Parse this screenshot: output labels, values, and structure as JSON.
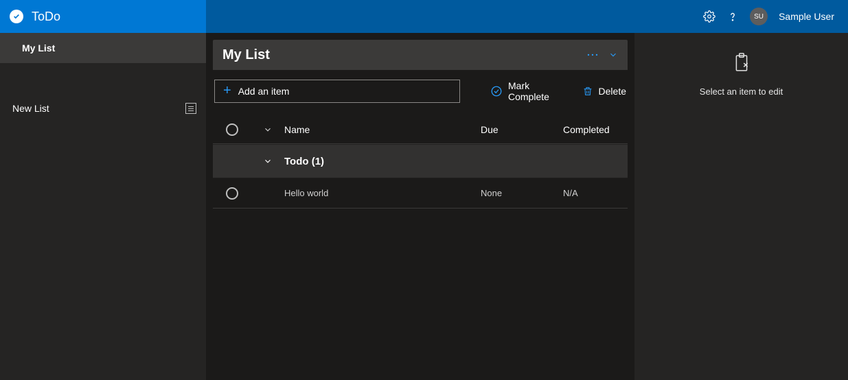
{
  "app": {
    "name": "ToDo"
  },
  "user": {
    "initials": "SU",
    "name": "Sample User"
  },
  "sidebar": {
    "selected": "My List",
    "new_list_label": "New List"
  },
  "list": {
    "title": "My List",
    "add_item_label": "Add an item",
    "mark_complete_label": "Mark Complete",
    "delete_label": "Delete",
    "columns": {
      "name": "Name",
      "due": "Due",
      "completed": "Completed"
    },
    "group_label": "Todo (1)",
    "items": [
      {
        "name": "Hello world",
        "due": "None",
        "completed": "N/A"
      }
    ]
  },
  "details": {
    "empty_message": "Select an item to edit"
  }
}
